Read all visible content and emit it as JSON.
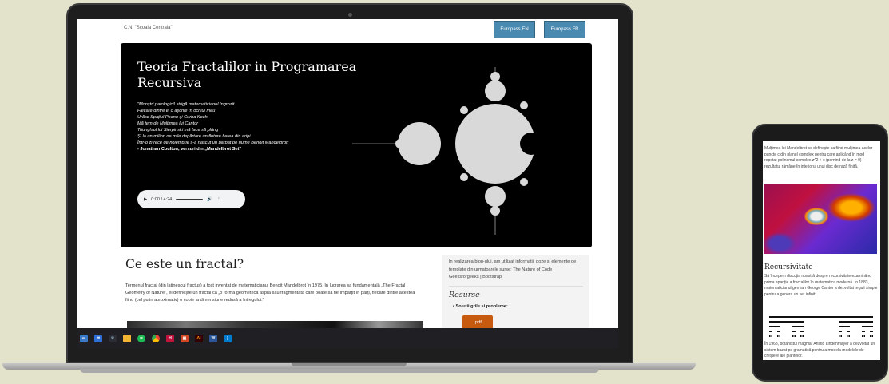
{
  "laptop": {
    "brand": "C.N. \"Scoala Centrala\"",
    "europass_en": "Europass EN",
    "europass_fr": "Europass FR",
    "hero": {
      "title": "Teoria Fractalilor in Programarea Recursiva",
      "poem": [
        "\"Monștri patologici! strigă matematicianul îngrozit",
        "Fiecare dintre ei o așchie în ochiul meu",
        "Urăsc Spațiul Peano și Curba Koch",
        "Mă tem de Mulțimea lui Cantor",
        "Triunghiul lui Sierpinski mă face să plâng",
        "Și la un milion de mile depărtare un fluture batea din aripi",
        "Într-o zi rece de noiembrie s-a născut un bărbat pe nume Benoit Mandelbrot\""
      ],
      "attribution": "- Jonathan Coulton, versuri din „Mandelbrot Set\"",
      "audio_time": "0:00 / 4:24"
    },
    "section_title": "Ce este un fractal?",
    "section_text": "Termenul fractal (din latinescul fractus) a fost inventat de matematicianul Benoit Mandelbrot în 1975. În lucrarea sa fundamentală „The Fractal Geometry of Nature\", el definește un fractal ca „o formă geometrică aspră sau fragmentată care poate să fie împărțit în părți, fiecare dintre acestea fiind (cel puțin aproximativ) o copie la dimensiune redusă a întregului.\"",
    "sidebar": {
      "intro": "In realizarea blog-ului, am utilizat informatii, poze si elemente de template din urmatoarele surse: The Nature of Code | Geeksforgeeks | Bootstrap",
      "resources_title": "Resurse",
      "item": "Solutii grile si probleme:",
      "pdf_label": ".pdf"
    },
    "taskbar_icons": [
      "files-icon",
      "mail-icon",
      "gear-icon",
      "folder-icon",
      "spotify-icon",
      "chrome-icon",
      "app-icon",
      "slides-icon",
      "illustrator-icon",
      "word-icon",
      "vscode-icon"
    ],
    "taskbar_labels": {
      "app": "H",
      "illustrator": "Ai"
    }
  },
  "phone": {
    "intro": "Mulțimea lui Mandelbrot se definește ca fiind mulțimea acelor puncte c din planul complex pentru care aplicând în mod repetat polinomul complex z^2 + c (pornind de la z = 0) rezultatul rămâne în interiorul unui disc de rază finită.",
    "heading": "Recursivitate",
    "recursion_text": "Să începem discuția noastră despre recursivitate examinând prima apariție a fractalilor în matematica modernă. În 1883, matematicianul german George Cantor a dezvoltat reguli simple pentru a genera un set infinit:",
    "lindenmayer_text": "În 1968, botanistul maghiar Aristid Lindenmayer a dezvoltat un sistem bazat pe gramatică pentru a modela modelele de creștere ale plantelor."
  }
}
